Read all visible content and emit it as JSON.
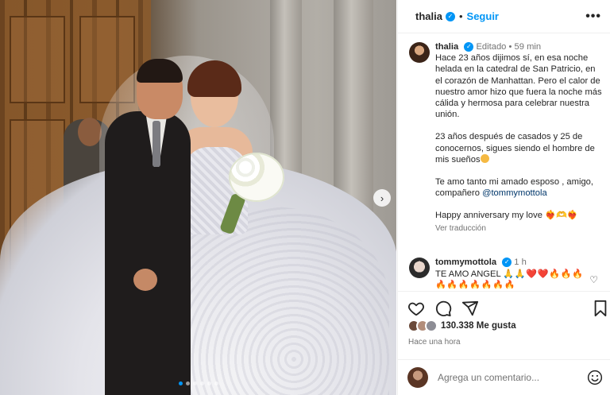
{
  "post": {
    "images_count": 6,
    "active_image_index": 0
  },
  "header": {
    "username": "thalia",
    "separator": "•",
    "follow_label": "Seguir",
    "more_label": "•••"
  },
  "caption": {
    "username": "thalia",
    "edited_label": "Editado",
    "dot": "•",
    "time": "59 min",
    "paragraph1": "Hace 23 años dijimos sí, en esa noche helada en la catedral de San Patricio, en el corazón de Manhattan. Pero el calor de nuestro amor hizo que fuera la noche más cálida y hermosa para celebrar nuestra unión.",
    "paragraph2": "23 años después de casados y 25 de conocernos, sigues siendo el hombre de mis sueños",
    "paragraph3_text": "Te amo tanto mi amado esposo , amigo, compañero",
    "paragraph3_mention": "@tommymottola",
    "paragraph4": "Happy anniversary my love",
    "paragraph4_emojis": "❤️‍🔥🫶❤️‍🔥",
    "translate_label": "Ver traducción"
  },
  "comment": {
    "username": "tommymottola",
    "time": "1 h",
    "text": "TE AMO ANGEL",
    "emojis_line1": "🙏🙏❤️❤️🔥🔥🔥",
    "emojis_line2": "🔥🔥🔥🔥🔥🔥🔥"
  },
  "actions": {
    "icons": [
      "heart-icon",
      "comment-icon",
      "share-icon",
      "save-icon"
    ]
  },
  "likes": {
    "count": "130.338",
    "label": "Me gusta"
  },
  "time_ago": "Hace una hora",
  "composer": {
    "placeholder": "Agrega un comentario..."
  },
  "colors": {
    "accent": "#0095f6",
    "muted": "#737373",
    "text": "#262626",
    "border": "#efefef"
  }
}
